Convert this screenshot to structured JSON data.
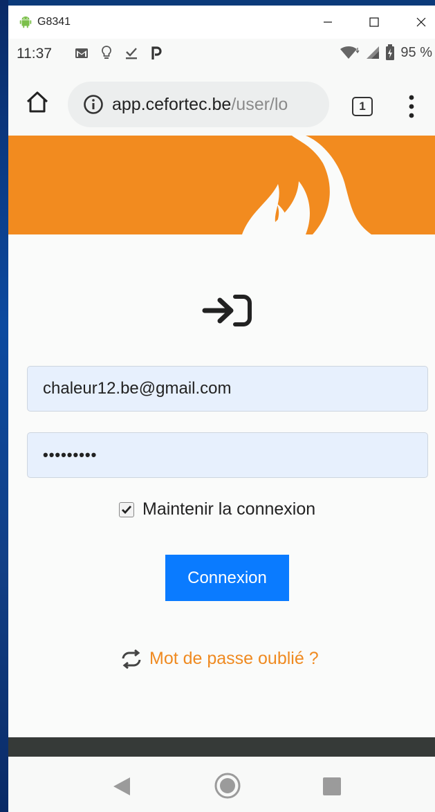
{
  "window": {
    "title": "G8341"
  },
  "status_bar": {
    "time": "11:37",
    "battery": "95 %",
    "icons": [
      "gmail-icon",
      "bulb-icon",
      "download-done-icon",
      "parking-icon",
      "wifi-icon",
      "signal-icon",
      "battery-icon"
    ]
  },
  "browser": {
    "url_host": "app.cefortec.be",
    "url_path": "/user/lo",
    "tab_count": "1"
  },
  "login": {
    "email_value": "chaleur12.be@gmail.com",
    "password_value": "•••••••••",
    "remember_label": "Maintenir la connexion",
    "remember_checked": true,
    "submit_label": "Connexion",
    "forgot_label": "Mot de passe oublié ?"
  },
  "colors": {
    "brand_orange": "#f28b1f",
    "button_blue": "#0a7bff",
    "link_orange": "#ef8a21"
  }
}
